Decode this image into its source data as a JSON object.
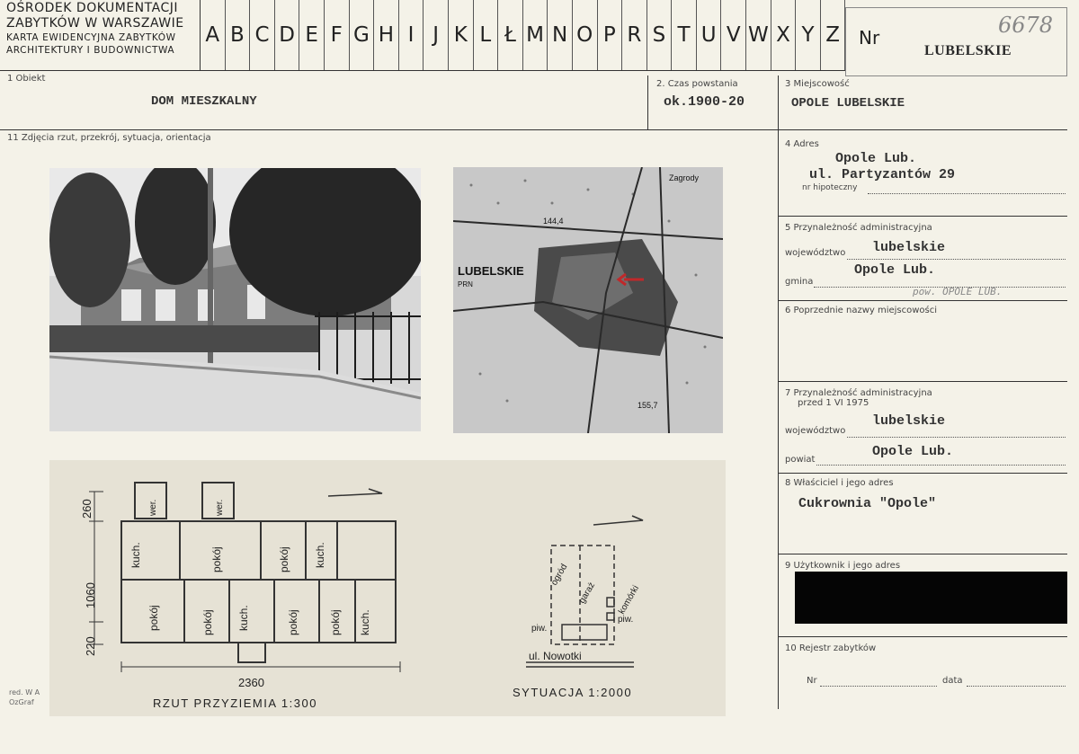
{
  "header": {
    "org_line1": "OŚRODEK DOKUMENTACJI",
    "org_line2": "ZABYTKÓW W WARSZAWIE",
    "org_line3": "KARTA EWIDENCYJNA ZABYTKÓW",
    "org_line4": "ARCHITEKTURY I BUDOWNICTWA",
    "letters": [
      "A",
      "B",
      "C",
      "D",
      "E",
      "F",
      "G",
      "H",
      "I",
      "J",
      "K",
      "L",
      "Ł",
      "M",
      "N",
      "O",
      "P",
      "R",
      "S",
      "T",
      "U",
      "V",
      "W",
      "X",
      "Y",
      "Z"
    ],
    "nr_label": "Nr",
    "region": "LUBELSKIE",
    "handwritten_number": "6678"
  },
  "fields": {
    "f1_label": "1 Obiekt",
    "f1_value": "DOM MIESZKALNY",
    "f2_label": "2. Czas powstania",
    "f2_value": "ok.1900-20",
    "f3_label": "3 Miejscowość",
    "f3_value": "OPOLE LUBELSKIE",
    "f11_label": "11 Zdjęcia rzut, przekrój, sytuacja, orientacja",
    "f4_label": "4 Adres",
    "f4_line1": "Opole Lub.",
    "f4_line2": "ul. Partyzantów 29",
    "f4_sub": "nr hipoteczny",
    "f5_label": "5 Przynależność administracyjna",
    "f5_woj_label": "województwo",
    "f5_woj_value": "lubelskie",
    "f5_gmina_label": "gmina",
    "f5_gmina_value": "Opole Lub.",
    "f5_note": "pow. OPOLE LUB.",
    "f6_label": "6 Poprzednie nazwy miejscowości",
    "f7_label": "7 Przynależność administracyjna",
    "f7_sub": "przed 1 VI 1975",
    "f7_woj_label": "województwo",
    "f7_woj_value": "lubelskie",
    "f7_powiat_label": "powiat",
    "f7_powiat_value": "Opole Lub.",
    "f8_label": "8 Właściciel i jego adres",
    "f8_value": "Cukrownia \"Opole\"",
    "f9_label": "9 Użytkownik i jego adres",
    "f10_label": "10 Rejestr zabytków",
    "f10_nr": "Nr",
    "f10_data": "data"
  },
  "map": {
    "label": "LUBELSKIE",
    "sub": "PRN",
    "elev1": "144,4",
    "elev2": "155,7",
    "place": "Zagrody"
  },
  "plan": {
    "rooms": [
      "kuch.",
      "pokój",
      "pokój",
      "kuch.",
      "pokój",
      "pokój",
      "kuch.",
      "pokój",
      "pokój",
      "kuch."
    ],
    "wer": "wer.",
    "dim_top": "260",
    "dim_mid": "1060",
    "dim_bot": "220",
    "dim_width": "2360",
    "caption_plan": "RZUT PRZYZIEMIA 1:300",
    "caption_sit": "SYTUACJA 1:2000",
    "ogrod": "ogród",
    "garaz": "garaż",
    "komorki": "komórki",
    "piw": "piw.",
    "street": "ul. Nowotki"
  },
  "footer": {
    "line1": "red. W A",
    "line2": "OzGraf"
  }
}
